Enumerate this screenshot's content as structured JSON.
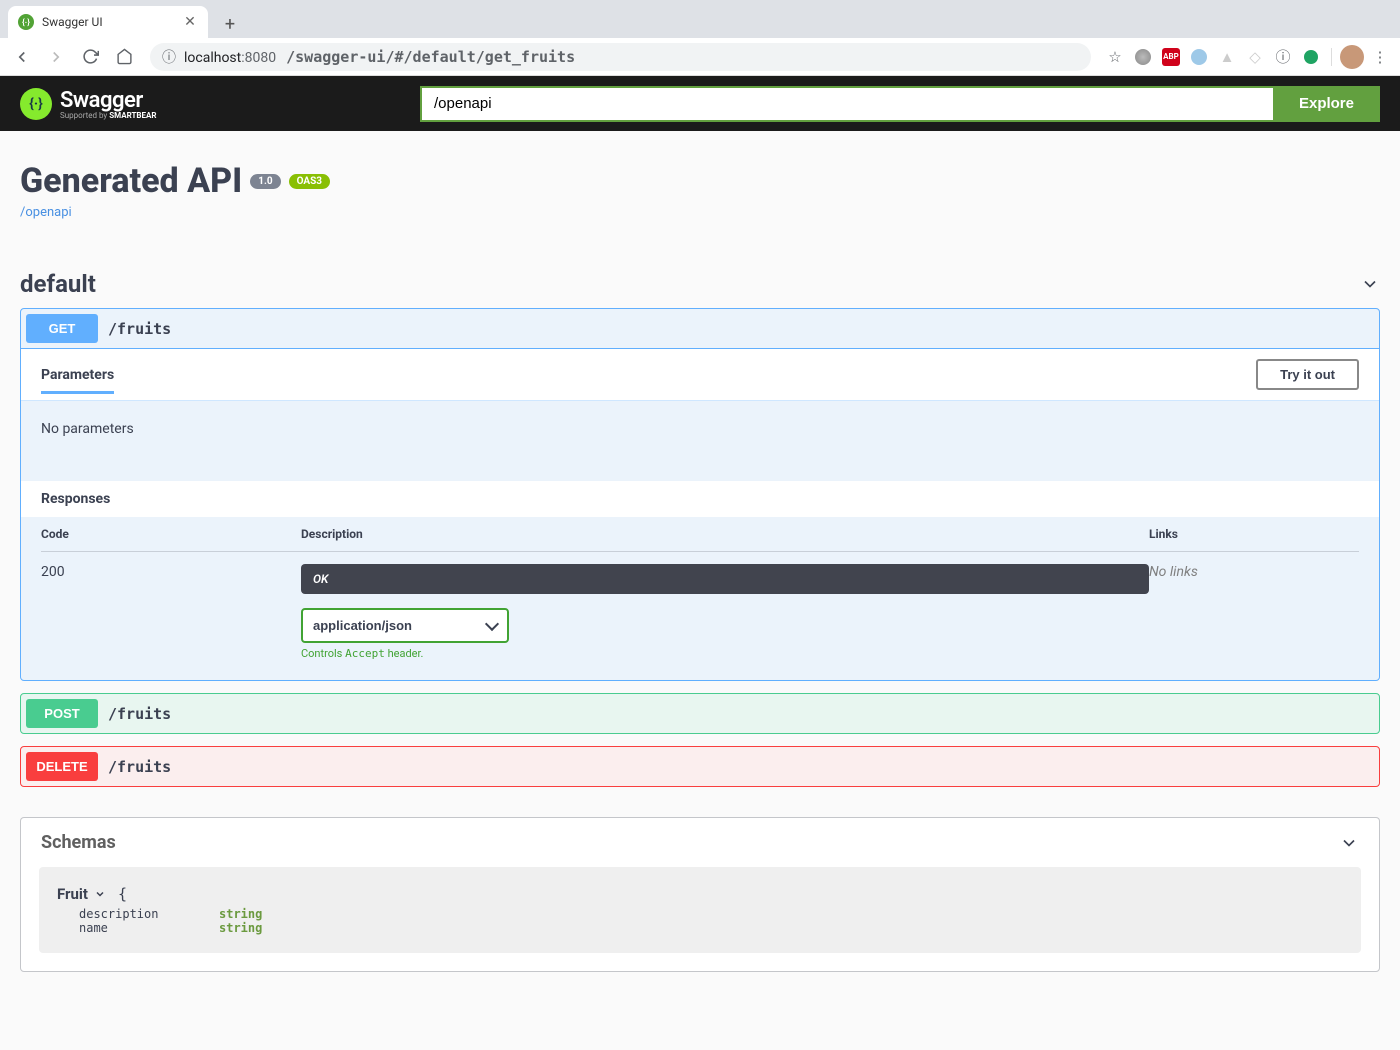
{
  "browser": {
    "tab_title": "Swagger UI",
    "url_host": "localhost",
    "url_port": ":8080",
    "url_path": "/swagger-ui/#/default/get_fruits",
    "ext_abp": "ABP"
  },
  "topbar": {
    "brand": "Swagger",
    "brand_sub_prefix": "Supported by ",
    "brand_sub_bold": "SMARTBEAR",
    "url_input_value": "/openapi",
    "explore_label": "Explore"
  },
  "api": {
    "title": "Generated API",
    "version": "1.0",
    "oas": "OAS3",
    "openapi_link": "/openapi"
  },
  "tag": {
    "name": "default"
  },
  "operations": {
    "get": {
      "method": "GET",
      "path": "/fruits"
    },
    "post": {
      "method": "POST",
      "path": "/fruits"
    },
    "delete": {
      "method": "DELETE",
      "path": "/fruits"
    }
  },
  "params": {
    "heading": "Parameters",
    "try_it_out": "Try it out",
    "no_params": "No parameters"
  },
  "responses": {
    "heading": "Responses",
    "col_code": "Code",
    "col_desc": "Description",
    "col_links": "Links",
    "row": {
      "code": "200",
      "ok_text": "OK",
      "no_links": "No links",
      "content_type": "application/json",
      "hint_prefix": "Controls ",
      "hint_mono": "Accept",
      "hint_suffix": " header."
    }
  },
  "schemas": {
    "heading": "Schemas",
    "model_name": "Fruit",
    "brace_open": "{",
    "props": [
      {
        "name": "description",
        "type": "string"
      },
      {
        "name": "name",
        "type": "string"
      }
    ]
  }
}
